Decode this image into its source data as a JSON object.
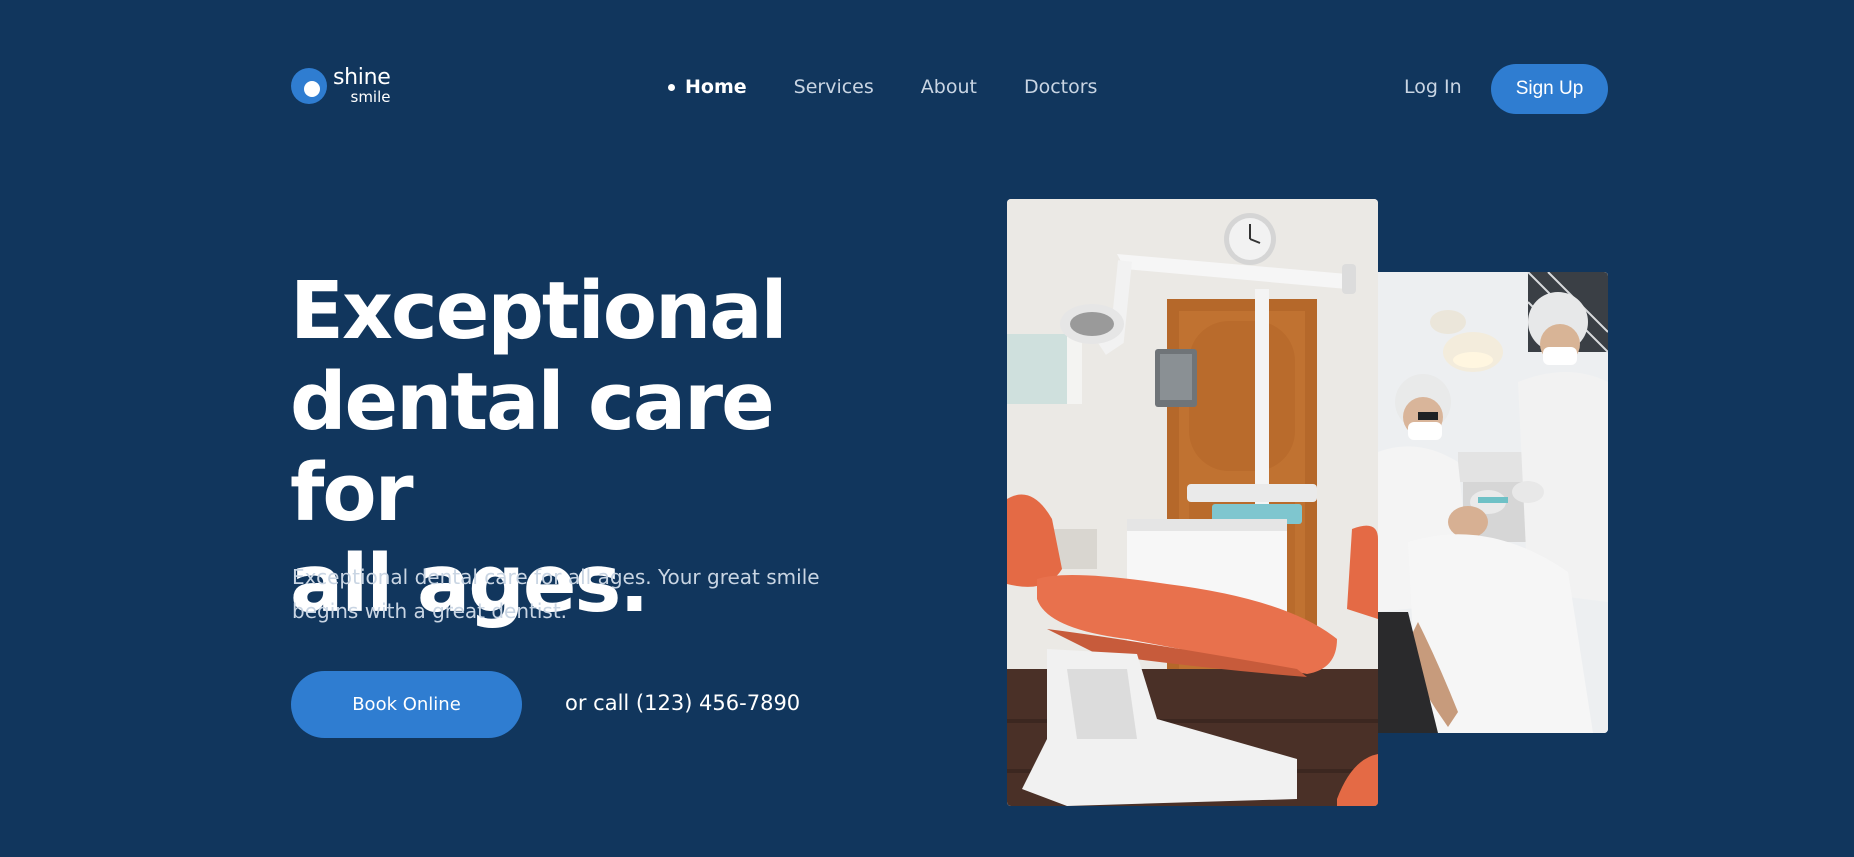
{
  "brand": {
    "name": "shine",
    "sub": "smile"
  },
  "nav": {
    "items": [
      {
        "label": "Home",
        "active": true
      },
      {
        "label": "Services",
        "active": false
      },
      {
        "label": "About",
        "active": false
      },
      {
        "label": "Doctors",
        "active": false
      }
    ]
  },
  "auth": {
    "login_label": "Log In",
    "signup_label": "Sign Up"
  },
  "hero": {
    "title_lines": [
      "Exceptional",
      "dental care for",
      "all ages."
    ],
    "subtitle_lines": [
      "Exceptional dental care for all ages. Your great smile",
      "begins with a great dentist."
    ],
    "book_label": "Book Online",
    "call_text": "or call (123) 456-7890"
  },
  "images": {
    "main": "dental-office-chair-photo",
    "side": "dentists-treating-patient-photo"
  },
  "colors": {
    "background": "#11365d",
    "accent": "#2f7dd1",
    "text": "#ffffff",
    "muted_text": "#c9d5e3"
  }
}
